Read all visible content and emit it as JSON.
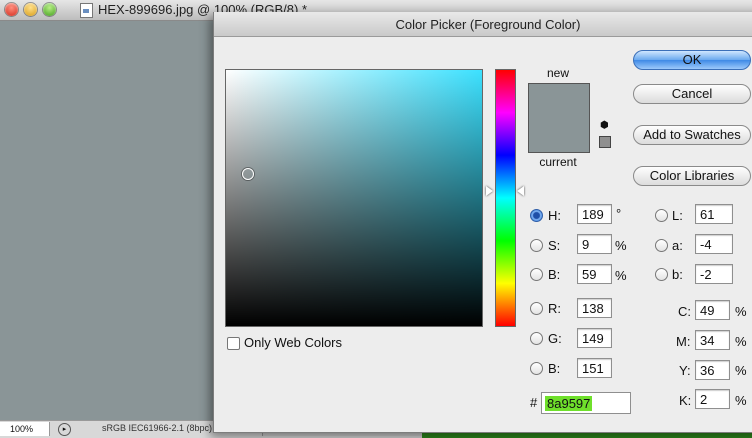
{
  "document": {
    "title": "HEX-899696.jpg @ 100% (RGB/8) *",
    "zoom": "100%",
    "profile": "sRGB IEC61966-2.1 (8bpc)"
  },
  "dialog": {
    "title": "Color Picker (Foreground Color)",
    "new_label": "new",
    "current_label": "current",
    "new_color": "#8a9597",
    "current_color": "#8a9597",
    "buttons": {
      "ok": "OK",
      "cancel": "Cancel",
      "add_to_swatches": "Add to Swatches",
      "color_libraries": "Color Libraries"
    },
    "only_web_colors": "Only Web Colors",
    "hsb": {
      "h_label": "H:",
      "h": "189",
      "h_unit": "°",
      "s_label": "S:",
      "s": "9",
      "s_unit": "%",
      "b_label": "B:",
      "b": "59",
      "b_unit": "%"
    },
    "rgb": {
      "r_label": "R:",
      "r": "138",
      "g_label": "G:",
      "g": "149",
      "b_label": "B:",
      "b": "151"
    },
    "lab": {
      "l_label": "L:",
      "l": "61",
      "a_label": "a:",
      "a": "-4",
      "b_label": "b:",
      "b": "-2"
    },
    "cmyk": {
      "c_label": "C:",
      "c": "49",
      "m_label": "M:",
      "m": "34",
      "y_label": "Y:",
      "y": "36",
      "k_label": "K:",
      "k": "2",
      "unit": "%"
    },
    "hex_label": "#",
    "hex": "8a9597"
  }
}
